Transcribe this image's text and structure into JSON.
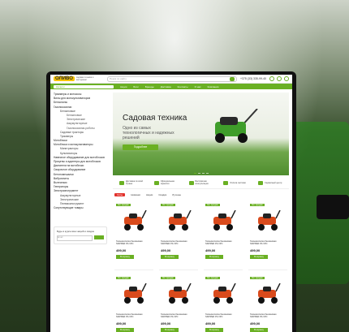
{
  "header": {
    "logo": "ОЛИВО",
    "tagline": "садовая техника и инструмент",
    "phone": "+375 (33) 335-99-40",
    "search_placeholder": "Поиск по сайту"
  },
  "nav": {
    "catalog_label": "Каталог",
    "links": [
      "Акции",
      "Блог",
      "Бренды",
      "Доставка",
      "Контакты",
      "О нас",
      "Компания"
    ]
  },
  "sidebar": {
    "items": [
      "Триммеры и мотокосы",
      "Вилы для мотокультиваторов",
      "Бензопилы",
      "Газонокосилки",
      "Бензиновые",
      "Бензиновые",
      "Электрические",
      "Аккумуляторные",
      "Газонокосилки-роботы",
      "Садовые тракторы",
      "Триммеры",
      "Мотоблоки",
      "Мотоблоки и мотокультиваторы",
      "Минитракторы",
      "Культиваторы",
      "Навесное оборудование для мотоблоков",
      "Прицепы и адаптеры для мотоблоков",
      "Двигатели на мотоблоки",
      "Сварочное оборудование",
      "Бетономешалки",
      "Виброплиты",
      "Вытесняки",
      "Генераторы",
      "Электроинструмент",
      "Аккумуляторные",
      "Электрические",
      "Пневмоинструмент",
      "Сопутствующие товары"
    ],
    "subscribe_title": "Будь в курсе всех акций и скидок",
    "subscribe_placeholder": "Email"
  },
  "banner": {
    "title": "Садовая техника",
    "subtitle": "Одно из самых технологичных и надежных решений",
    "button": "Подробнее"
  },
  "features": [
    "Доставка по всей стране",
    "Официальная гарантия",
    "Бесплатная консультация",
    "Оплата частями",
    "Сервисный центр"
  ],
  "tabs": [
    "Хиты",
    "Новинки",
    "Акции",
    "Скидки",
    "Лучшее"
  ],
  "products": [
    {
      "badge": "Хит продаж",
      "name": "Газонокосилка бензиновая SKIPPER PF-VPC",
      "price": "499,00",
      "button": "В корзину"
    },
    {
      "badge": "Хит продаж",
      "name": "Газонокосилка бензиновая SKIPPER PF-VPC",
      "price": "499,00",
      "button": "В корзину"
    },
    {
      "badge": "Хит продаж",
      "name": "Газонокосилка бензиновая SKIPPER PF-VPC",
      "price": "499,00",
      "button": "В корзину"
    },
    {
      "badge": "Хит продаж",
      "name": "Газонокосилка бензиновая SKIPPER PF-VPC",
      "price": "499,00",
      "button": "В корзину"
    },
    {
      "badge": "Хит продаж",
      "name": "Газонокосилка бензиновая SKIPPER PF-VPC",
      "price": "499,00",
      "button": "В корзину"
    },
    {
      "badge": "Хит продаж",
      "name": "Газонокосилка бензиновая SKIPPER PF-VPC",
      "price": "499,00",
      "button": "В корзину"
    },
    {
      "badge": "Хит продаж",
      "name": "Газонокосилка бензиновая SKIPPER PF-VPC",
      "price": "499,00",
      "button": "В корзину"
    },
    {
      "badge": "Хит продаж",
      "name": "Газонокосилка бензиновая SKIPPER PF-VPC",
      "price": "499,00",
      "button": "В корзину"
    }
  ],
  "colors": {
    "accent": "#6ab023",
    "sale": "#e2312b"
  }
}
